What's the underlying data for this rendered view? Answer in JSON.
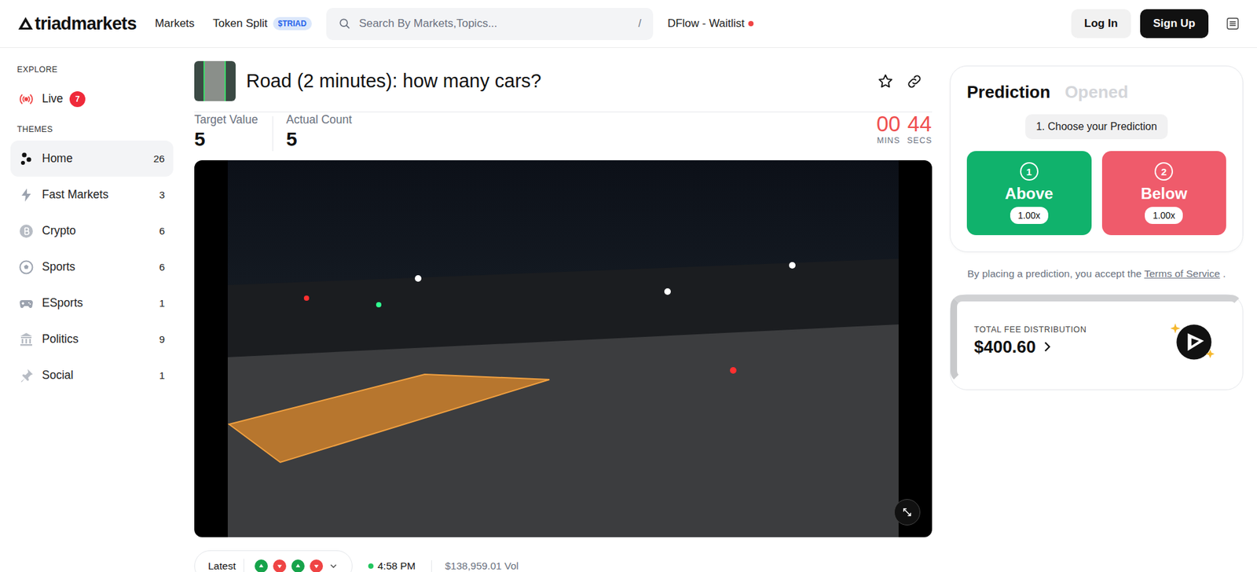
{
  "header": {
    "logo": "triadmarkets",
    "nav": [
      {
        "label": "Markets",
        "badge": ""
      },
      {
        "label": "Token Split",
        "badge": "$TRIAD"
      }
    ],
    "search": {
      "placeholder": "Search By Markets,Topics...",
      "shortcut": "/"
    },
    "waitlist": {
      "label": "DFlow - Waitlist",
      "color": "#ef4444"
    },
    "buttons": [
      {
        "label": "Log In",
        "kind": "secondary"
      },
      {
        "label": "Sign Up",
        "kind": "primary"
      }
    ]
  },
  "sidebar": {
    "sections": [
      {
        "title": "EXPLORE",
        "items": [
          {
            "label": "Live",
            "badge": "7",
            "count": "",
            "selected": false
          }
        ]
      },
      {
        "title": "THEMES",
        "items": [
          {
            "label": "Home",
            "badge": "",
            "count": "26",
            "selected": true
          },
          {
            "label": "Fast Markets",
            "badge": "",
            "count": "3",
            "selected": false
          },
          {
            "label": "Crypto",
            "badge": "",
            "count": "6",
            "selected": false
          },
          {
            "label": "Sports",
            "badge": "",
            "count": "6",
            "selected": false
          },
          {
            "label": "ESports",
            "badge": "",
            "count": "1",
            "selected": false
          },
          {
            "label": "Politics",
            "badge": "",
            "count": "9",
            "selected": false
          },
          {
            "label": "Social",
            "badge": "",
            "count": "1",
            "selected": false
          }
        ]
      }
    ]
  },
  "market": {
    "title": "Road (2 minutes): how many cars?",
    "stats": [
      {
        "label": "Target Value",
        "value": "5"
      },
      {
        "label": "Actual Count",
        "value": "5"
      }
    ],
    "timer": [
      {
        "value": "00",
        "unit": "MINS"
      },
      {
        "value": "44",
        "unit": "SECS"
      }
    ]
  },
  "history": {
    "filter": "Latest",
    "results": [
      {
        "outcome": "above",
        "color": "#16a34a"
      },
      {
        "outcome": "below",
        "color": "#ef4444"
      },
      {
        "outcome": "above",
        "color": "#16a34a"
      },
      {
        "outcome": "below",
        "color": "#ef4444"
      }
    ],
    "time": "4:58 PM",
    "volume": "$138,959.01 Vol"
  },
  "prediction": {
    "tabs": [
      {
        "label": "Prediction",
        "selected": true
      },
      {
        "label": "Opened",
        "selected": false
      }
    ],
    "step": "1. Choose your Prediction",
    "options": [
      {
        "number": "1",
        "label": "Above",
        "multiplier": "1.00x",
        "color": "#10b26c"
      },
      {
        "number": "2",
        "label": "Below",
        "multiplier": "1.00x",
        "color": "#ef5b6b"
      }
    ],
    "terms": {
      "before": "By placing a prediction, you accept the",
      "link": "Terms of Service",
      "after": "."
    }
  },
  "fees": {
    "label": "TOTAL FEE DISTRIBUTION",
    "amount": "$400.60"
  }
}
